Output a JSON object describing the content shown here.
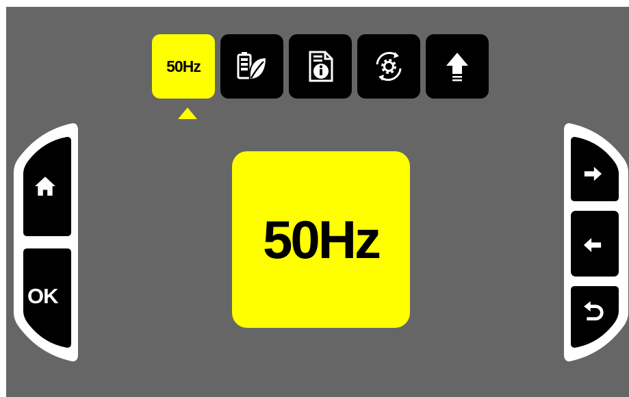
{
  "colors": {
    "screen_bg": "#666666",
    "accent": "#ffff00",
    "button_bg": "#000000",
    "frame": "#ffffff"
  },
  "tabs": [
    {
      "label": "50Hz",
      "icon": "frequency",
      "active": true
    },
    {
      "label": "",
      "icon": "eco-battery-icon",
      "active": false
    },
    {
      "label": "",
      "icon": "info-document-icon",
      "active": false
    },
    {
      "label": "",
      "icon": "settings-sync-icon",
      "active": false
    },
    {
      "label": "",
      "icon": "upload-arrow-icon",
      "active": false
    }
  ],
  "display": {
    "value": "50Hz"
  },
  "left_panel": {
    "home": {
      "icon": "home-icon"
    },
    "ok": {
      "label": "OK"
    }
  },
  "right_panel": {
    "next": {
      "icon": "arrow-right-icon"
    },
    "prev": {
      "icon": "arrow-left-icon"
    },
    "back": {
      "icon": "return-icon"
    }
  }
}
